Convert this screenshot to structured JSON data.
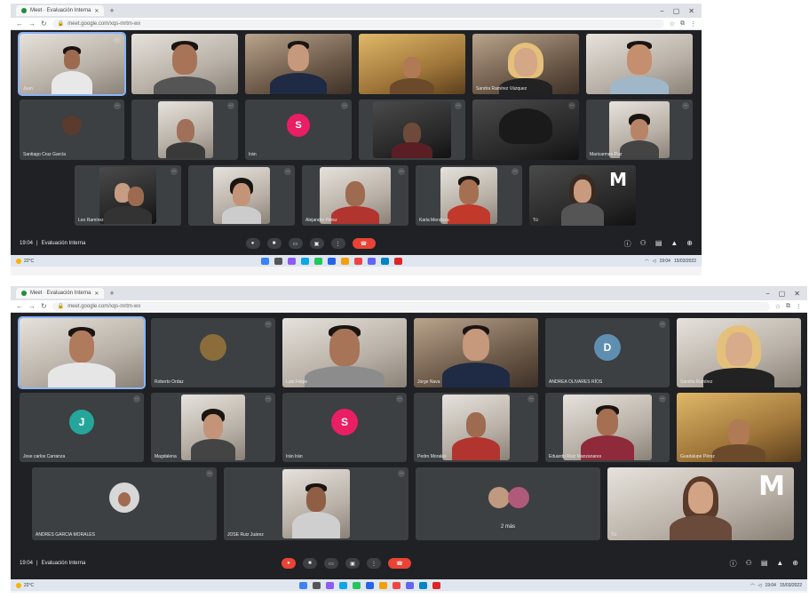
{
  "screenshots": [
    {
      "id": "shot1",
      "browser": {
        "tab_title": "Meet · Evaluación Interna",
        "url": "meet.google.com/xqs-mrtm-wx",
        "window_controls": [
          "−",
          "▢",
          "✕"
        ]
      },
      "meeting": {
        "time": "19:04",
        "title": "Evaluación Interna",
        "avatar_letter": "S",
        "participants": [
          "Juan",
          "",
          "",
          "",
          "Sandra Ramírez Vázquez",
          "",
          "Santiago Cruz García",
          "",
          "Irán",
          "",
          "",
          "Maricarmen Paz",
          "Leo Ramírez",
          "",
          "Alejandro Pérez",
          "Karla Mendoza",
          "Tú"
        ],
        "logo": "M"
      },
      "taskbar": {
        "weather": "22°C",
        "time": "19:04",
        "date": "15/03/2022"
      }
    },
    {
      "id": "shot2",
      "browser": {
        "tab_title": "Meet · Evaluación Interna",
        "url": "meet.google.com/xqs-mrtm-wx",
        "window_controls": [
          "−",
          "▢",
          "✕"
        ]
      },
      "meeting": {
        "time": "19:04",
        "title": "Evaluación Interna",
        "avatar_letters": [
          "D",
          "J",
          "S"
        ],
        "participants": [
          "",
          "Roberto Ordaz",
          "Luis Felipe",
          "Jorge Nava",
          "ANDREA OLIVARES RÍOS",
          "Sandra Ramírez",
          "Jose carlos Carranza",
          "Magdalena",
          "Irán Irán",
          "Pedro Morales",
          "Eduardo Ruiz Manzanares",
          "Guadalupe Pérez",
          "ANDRES GARCIA MORALES",
          "JOSE Ruiz Juárez",
          "2 más",
          "Tú"
        ],
        "logo": "M"
      },
      "taskbar": {
        "weather": "22°C",
        "time": "19:04",
        "date": "15/03/2022"
      }
    }
  ],
  "colors": {
    "meet_bg": "#202124",
    "tile_bg": "#3c4043",
    "hangup": "#ea4335",
    "avatar_pink": "#e91e63",
    "avatar_teal": "#26a69a",
    "avatar_blue": "#5f8fb0",
    "active_outline": "#8ab4f8"
  },
  "icons": [
    "mic-icon",
    "camera-icon",
    "caption-icon",
    "present-icon",
    "more-icon",
    "hangup-icon",
    "info-icon",
    "people-icon",
    "chat-icon",
    "activities-icon",
    "lock-icon",
    "mute-icon"
  ]
}
